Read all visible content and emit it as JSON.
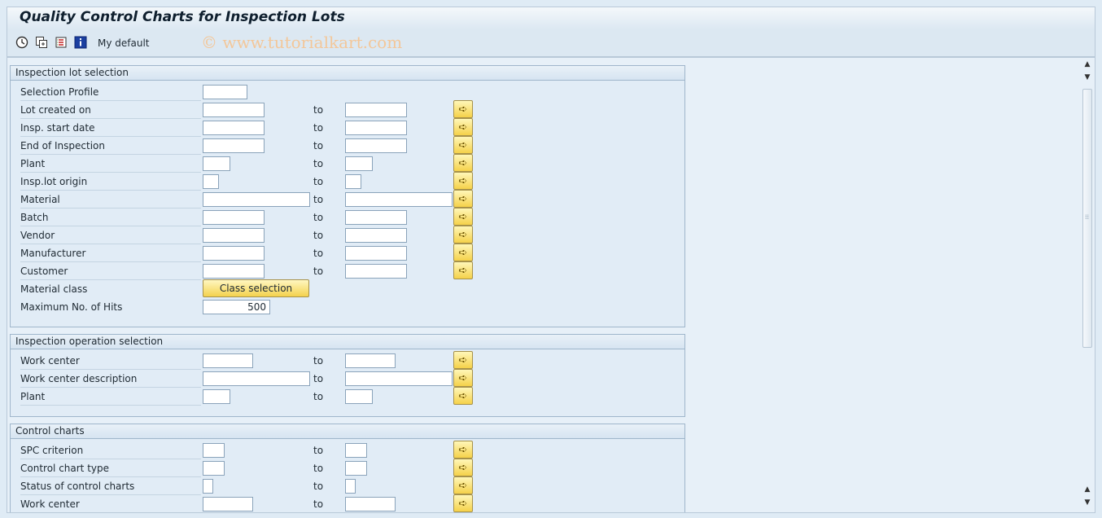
{
  "window": {
    "title": "Quality Control Charts for Inspection Lots",
    "watermark": "© www.tutorialkart.com"
  },
  "toolbar": {
    "icons": [
      "execute-icon",
      "variant-get-icon",
      "list-icon",
      "info-icon"
    ],
    "variant_label": "My default"
  },
  "common": {
    "to_label": "to",
    "more_icon": "arrow-right-icon"
  },
  "groups": {
    "inspection_lot": {
      "title": "Inspection lot selection",
      "rows": [
        {
          "label": "Selection Profile",
          "from": "",
          "to": null
        },
        {
          "label": "Lot created on",
          "from": "",
          "to": ""
        },
        {
          "label": "Insp. start date",
          "from": "",
          "to": ""
        },
        {
          "label": "End of Inspection",
          "from": "",
          "to": ""
        },
        {
          "label": "Plant",
          "from": "",
          "to": ""
        },
        {
          "label": "Insp.lot origin",
          "from": "",
          "to": ""
        },
        {
          "label": "Material",
          "from": "",
          "to": ""
        },
        {
          "label": "Batch",
          "from": "",
          "to": ""
        },
        {
          "label": "Vendor",
          "from": "",
          "to": ""
        },
        {
          "label": "Manufacturer",
          "from": "",
          "to": ""
        },
        {
          "label": "Customer",
          "from": "",
          "to": ""
        },
        {
          "label": "Material class",
          "button": "Class selection"
        },
        {
          "label": "Maximum No. of Hits",
          "value": "500"
        }
      ]
    },
    "inspection_operation": {
      "title": "Inspection operation selection",
      "rows": [
        {
          "label": "Work center",
          "from": "",
          "to": ""
        },
        {
          "label": "Work center description",
          "from": "",
          "to": ""
        },
        {
          "label": "Plant",
          "from": "",
          "to": ""
        }
      ]
    },
    "control_charts": {
      "title": "Control charts",
      "rows": [
        {
          "label": "SPC criterion",
          "from": "",
          "to": ""
        },
        {
          "label": "Control chart type",
          "from": "",
          "to": ""
        },
        {
          "label": "Status of control charts",
          "from": "",
          "to": ""
        },
        {
          "label": "Work center",
          "from": "",
          "to": ""
        }
      ]
    }
  }
}
